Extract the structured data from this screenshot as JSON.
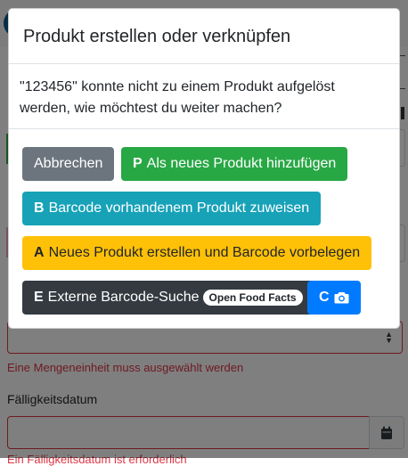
{
  "background": {
    "quantity_unit_error": "Eine Mengeneinheit muss ausgewählt werden",
    "due_date_label": "Fälligkeitsdatum",
    "due_date_error": "Ein Fälligkeitsdatum ist erforderlich"
  },
  "modal": {
    "title": "Produkt erstellen oder verknüpfen",
    "message": "\"123456\" konnte nicht zu einem Produkt aufgelöst werden, wie möchtest du weiter machen?",
    "buttons": {
      "cancel": "Abbrechen",
      "add_new_key": "P",
      "add_new": "Als neues Produkt hinzufügen",
      "assign_key": "B",
      "assign": "Barcode vorhandenem Produkt zuweisen",
      "create_key": "A",
      "create": "Neues Produkt erstellen und Barcode vorbelegen",
      "external_key": "E",
      "external": "Externe Barcode-Suche",
      "external_badge": "Open Food Facts",
      "camera_key": "C"
    }
  },
  "colors": {
    "secondary": "#6c757d",
    "success": "#28a745",
    "info": "#17a2b8",
    "warning": "#ffc107",
    "dark": "#343a40",
    "primary": "#007bff",
    "danger": "#dc3545"
  },
  "icons": {
    "camera": "camera-icon",
    "calendar": "calendar-icon",
    "caret": "select-caret-icon"
  }
}
